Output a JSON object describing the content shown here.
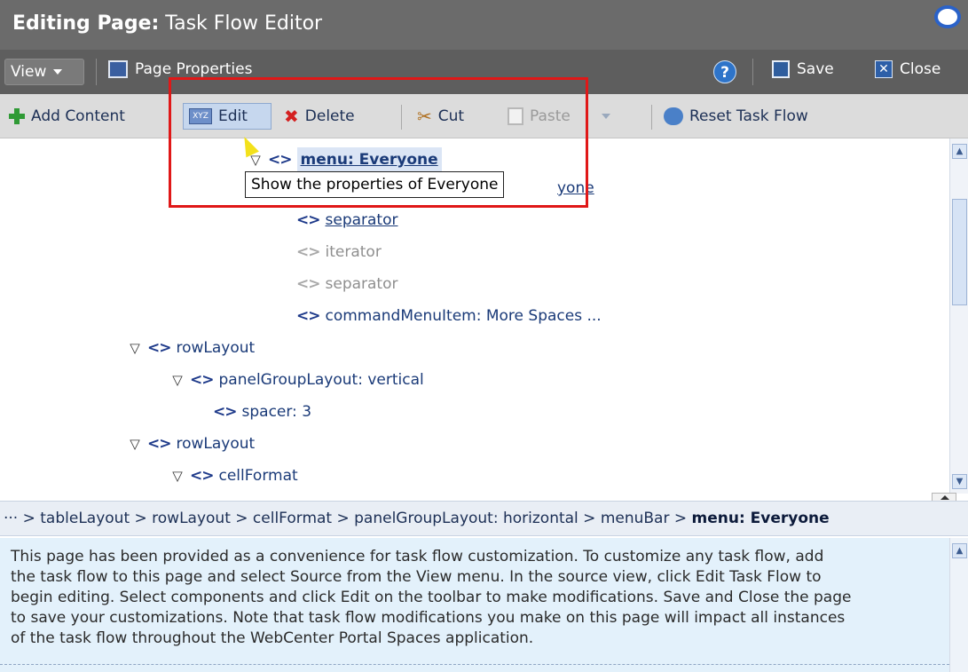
{
  "titlebar": {
    "prefix": "Editing Page:",
    "name": "Task Flow Editor"
  },
  "menubar": {
    "view": "View",
    "page_properties": "Page Properties",
    "help": "?",
    "save": "Save",
    "close": "Close"
  },
  "toolbar": {
    "add_content": "Add Content",
    "edit": "Edit",
    "delete": "Delete",
    "cut": "Cut",
    "paste": "Paste",
    "reset": "Reset Task Flow"
  },
  "tooltip": "Show the properties of Everyone",
  "tree": {
    "selected": "menu: Everyone",
    "partial": "yone",
    "items": [
      "separator",
      "iterator",
      "separator",
      "commandMenuItem: More Spaces ...",
      "rowLayout",
      "panelGroupLayout: vertical",
      "spacer: 3",
      "rowLayout",
      "cellFormat"
    ]
  },
  "breadcrumb": {
    "path": "··· > tableLayout > rowLayout > cellFormat > panelGroupLayout: horizontal > menuBar > ",
    "current": "menu: Everyone"
  },
  "info": {
    "lines": [
      "This page has been provided as a convenience for task flow customization. To customize any task flow, add",
      "the task flow to this page and select Source from the View menu. In the source view, click Edit Task Flow to",
      "begin editing. Select components and click Edit on the toolbar to make modifications. Save and Close the page",
      "to save your customizations. Note that task flow modifications you make on this page will impact all instances",
      "of the task flow throughout the WebCenter Portal Spaces application."
    ]
  },
  "colors": {
    "titlebar": "#6b6b6b",
    "menubar": "#5e5e5e",
    "toolbar": "#dcdcdc",
    "highlight": "#e01818",
    "info_bg": "#e3f1fb"
  }
}
